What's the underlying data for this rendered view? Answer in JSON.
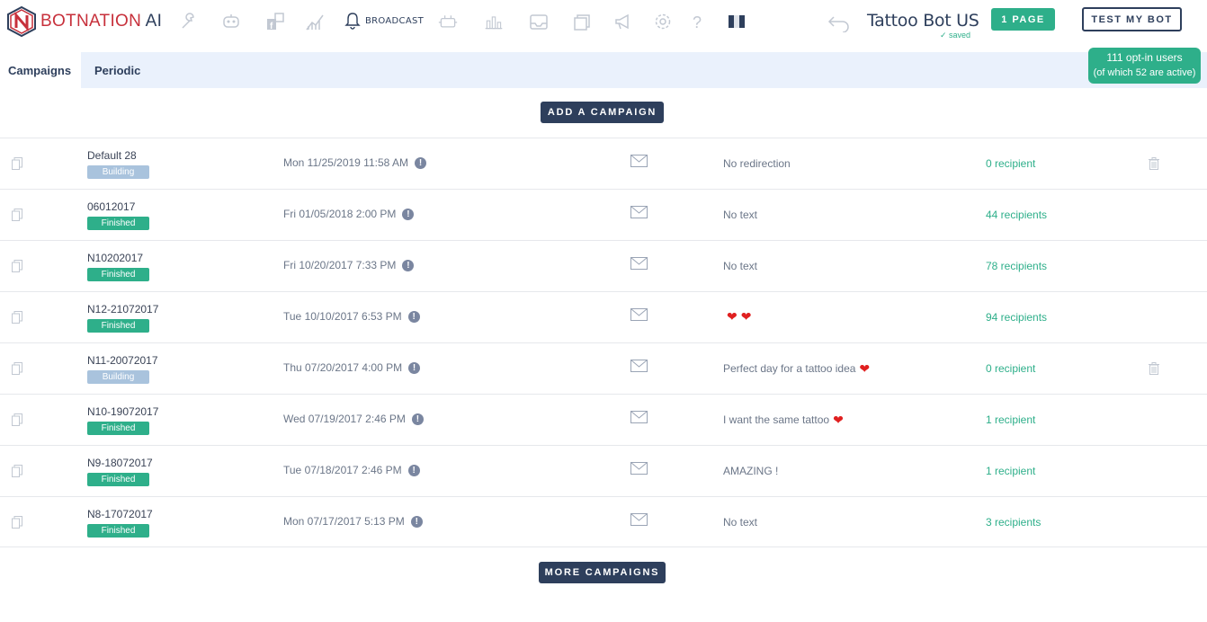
{
  "header": {
    "logo_text_main": "BOTNATION",
    "logo_text_ai": "AI",
    "broadcast_label": "BROADCAST",
    "bot_name": "Tattoo Bot US",
    "saved_label": "saved",
    "pages_button": "1 PAGE",
    "test_button": "TEST MY BOT",
    "nav_icons": [
      "wrench-icon",
      "robot-face-icon",
      "facebook-pages-icon",
      "analytics-icon",
      "bell-icon",
      "plugins-icon",
      "stats-icon",
      "inbox-icon",
      "cards-icon",
      "megaphone-icon",
      "gear-icon",
      "help-icon",
      "flag-icon"
    ]
  },
  "tabs": [
    {
      "label": "Campaigns",
      "active": true
    },
    {
      "label": "Periodic",
      "active": false
    }
  ],
  "optin": {
    "line1": "111 opt-in users",
    "line2": "(of which 52 are active)"
  },
  "add_campaign_button": "ADD A CAMPAIGN",
  "more_campaigns_button": "MORE CAMPAIGNS",
  "campaigns": [
    {
      "name": "Default 28",
      "status": "Building",
      "date": "Mon 11/25/2019 11:58 AM",
      "message": "No redirection",
      "hearts": 0,
      "recipients": "0 recipient",
      "deletable": true
    },
    {
      "name": "06012017",
      "status": "Finished",
      "date": "Fri 01/05/2018 2:00 PM",
      "message": "No text",
      "hearts": 0,
      "recipients": "44 recipients",
      "deletable": false
    },
    {
      "name": "N10202017",
      "status": "Finished",
      "date": "Fri 10/20/2017 7:33 PM",
      "message": "No text",
      "hearts": 0,
      "recipients": "78 recipients",
      "deletable": false
    },
    {
      "name": "N12-21072017",
      "status": "Finished",
      "date": "Tue 10/10/2017 6:53 PM",
      "message": "",
      "hearts": 2,
      "recipients": "94 recipients",
      "deletable": false
    },
    {
      "name": "N11-20072017",
      "status": "Building",
      "date": "Thu 07/20/2017 4:00 PM",
      "message": "Perfect day for a tattoo idea",
      "hearts": 1,
      "recipients": "0 recipient",
      "deletable": true
    },
    {
      "name": "N10-19072017",
      "status": "Finished",
      "date": "Wed 07/19/2017 2:46 PM",
      "message": "I want the same tattoo",
      "hearts": 1,
      "recipients": "1 recipient",
      "deletable": false
    },
    {
      "name": "N9-18072017",
      "status": "Finished",
      "date": "Tue 07/18/2017 2:46 PM",
      "message": "AMAZING !",
      "hearts": 0,
      "recipients": "1 recipient",
      "deletable": false
    },
    {
      "name": "N8-17072017",
      "status": "Finished",
      "date": "Mon 07/17/2017 5:13 PM",
      "message": "No text",
      "hearts": 0,
      "recipients": "3 recipients",
      "deletable": false
    }
  ],
  "colors": {
    "primary_dark": "#2e3f5c",
    "green": "#2eaf8a",
    "building_badge": "#a9c3dd",
    "tab_bar": "#eaf1fc"
  }
}
